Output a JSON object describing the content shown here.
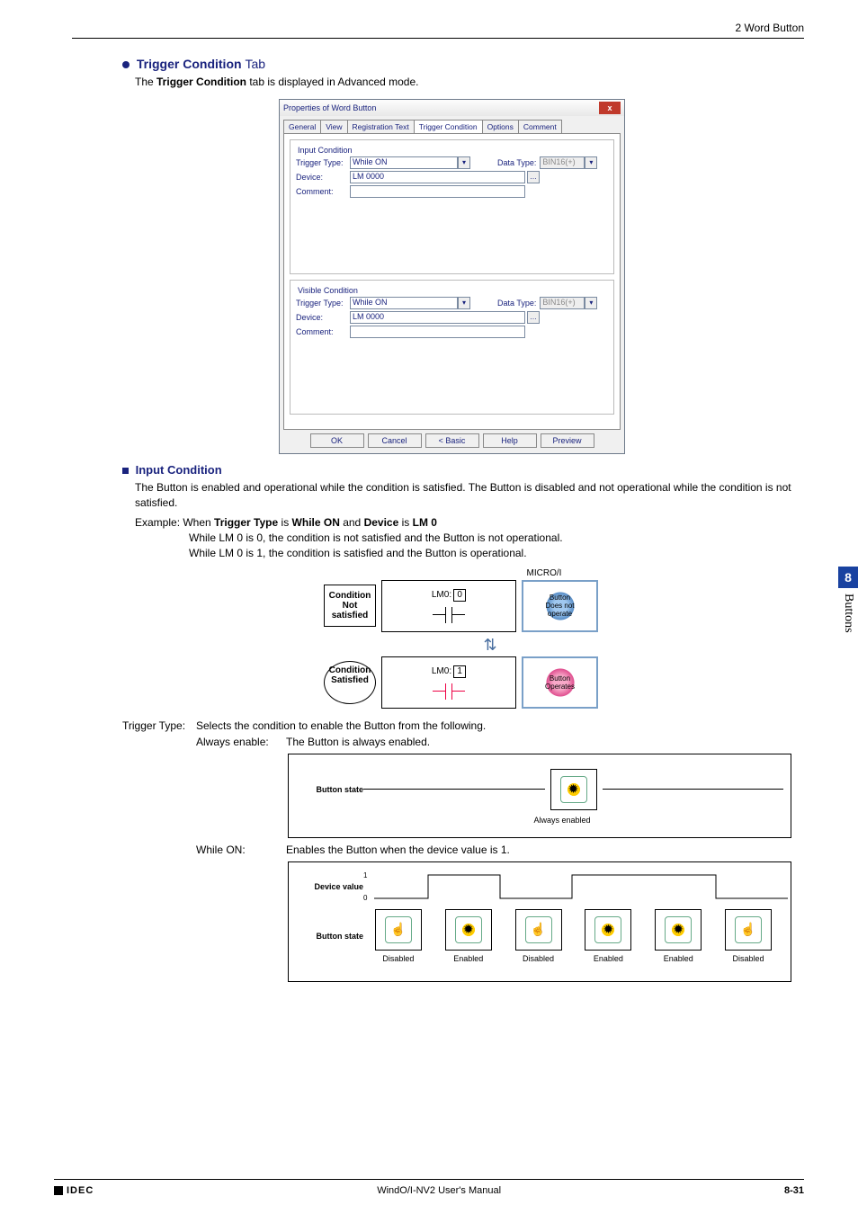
{
  "header": {
    "title": "2 Word Button"
  },
  "heading": {
    "bullet": "Trigger Condition",
    "tab_word": "Tab"
  },
  "subheading_text": "The Trigger Condition tab is displayed in Advanced mode.",
  "subheading_bold": "Trigger Condition",
  "dialog": {
    "title": "Properties of Word Button",
    "tabs": [
      "General",
      "View",
      "Registration Text",
      "Trigger Condition",
      "Options",
      "Comment"
    ],
    "active_tab": 3,
    "input_condition": {
      "legend": "Input Condition",
      "trigger_type_label": "Trigger Type:",
      "trigger_type_value": "While ON",
      "data_type_label": "Data Type:",
      "data_type_value": "BIN16(+)",
      "device_label": "Device:",
      "device_value": "LM 0000",
      "comment_label": "Comment:",
      "comment_value": ""
    },
    "visible_condition": {
      "legend": "Visible Condition",
      "trigger_type_label": "Trigger Type:",
      "trigger_type_value": "While ON",
      "data_type_label": "Data Type:",
      "data_type_value": "BIN16(+)",
      "device_label": "Device:",
      "device_value": "LM 0000",
      "comment_label": "Comment:",
      "comment_value": ""
    },
    "buttons": {
      "ok": "OK",
      "cancel": "Cancel",
      "basic": "< Basic",
      "help": "Help",
      "preview": "Preview"
    }
  },
  "input_condition_section": {
    "heading": "Input Condition",
    "desc": "The Button is enabled and operational while the condition is satisfied. The Button is disabled and not operational while the condition is not satisfied.",
    "example_prefix": "Example: When ",
    "example_bold1": "Trigger Type",
    "example_mid1": " is ",
    "example_bold2": "While ON",
    "example_mid2": " and ",
    "example_bold3": "Device",
    "example_mid3": " is ",
    "example_bold4": "LM 0",
    "line1": "While LM 0 is 0, the condition is not satisfied and the Button is not operational.",
    "line2": "While LM 0 is 1, the condition is satisfied and the Button is operational."
  },
  "micro_diagram": {
    "title": "MICRO/I",
    "not_satisfied": "Condition Not satisfied",
    "satisfied": "Condition Satisfied",
    "lm0_label": "LM0:",
    "lm0_val0": "0",
    "lm0_val1": "1",
    "btn_not_operate": "Button Does not operate",
    "btn_operates": "Button Operates"
  },
  "trigger_type_def": {
    "label": "Trigger Type:",
    "desc": "Selects the condition to enable the Button from the following.",
    "always_enable_label": "Always enable:",
    "always_enable_desc": "The Button is always enabled.",
    "while_on_label": "While ON:",
    "while_on_desc": "Enables the Button when the device value is 1."
  },
  "state_diagram": {
    "button_state_label": "Button state",
    "device_value_label": "Device value",
    "always_enabled": "Always enabled",
    "axis_1": "1",
    "axis_0": "0",
    "captions": [
      "Disabled",
      "Enabled",
      "Disabled",
      "Enabled",
      "Enabled",
      "Disabled"
    ]
  },
  "side_tab": {
    "number": "8",
    "text": "Buttons"
  },
  "footer": {
    "brand": "IDEC",
    "manual": "WindO/I-NV2 User's Manual",
    "page": "8-31"
  }
}
